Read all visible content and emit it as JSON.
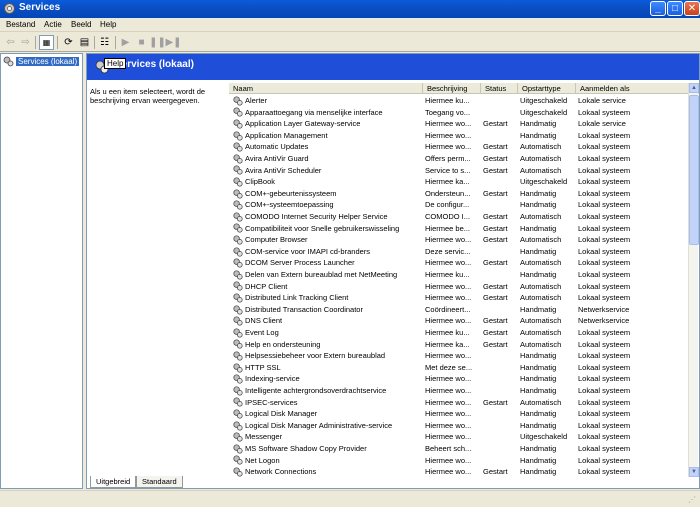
{
  "window": {
    "title": "Services",
    "minimize_glyph": "_",
    "maximize_glyph": "□",
    "close_glyph": "✕"
  },
  "menu": [
    "Bestand",
    "Actie",
    "Beeld",
    "Help"
  ],
  "toolbar_icons": [
    "back-arrow-icon",
    "forward-arrow-icon",
    "show-hide-tree-icon",
    "refresh-icon",
    "export-list-icon",
    "properties-icon",
    "start-service-icon",
    "stop-service-icon",
    "pause-service-icon",
    "restart-service-icon"
  ],
  "tree": {
    "root_label": "Services (lokaal)"
  },
  "banner": {
    "title": "Services (lokaal)",
    "tooltip": "Help"
  },
  "description_text": "Als u een item selecteert, wordt de beschrijving ervan weergegeven.",
  "columns": [
    "Naam",
    "Beschrijving",
    "Status",
    "Opstarttype",
    "Aanmelden als"
  ],
  "rows": [
    {
      "name": "Alerter",
      "desc": "Hiermee ku...",
      "status": "",
      "type": "Uitgeschakeld",
      "logon": "Lokale service"
    },
    {
      "name": "Apparaattoegang via menselijke interface",
      "desc": "Toegang vo...",
      "status": "",
      "type": "Uitgeschakeld",
      "logon": "Lokaal systeem"
    },
    {
      "name": "Application Layer Gateway-service",
      "desc": "Hiermee wo...",
      "status": "Gestart",
      "type": "Handmatig",
      "logon": "Lokale service"
    },
    {
      "name": "Application Management",
      "desc": "Hiermee wo...",
      "status": "",
      "type": "Handmatig",
      "logon": "Lokaal systeem"
    },
    {
      "name": "Automatic Updates",
      "desc": "Hiermee wo...",
      "status": "Gestart",
      "type": "Automatisch",
      "logon": "Lokaal systeem"
    },
    {
      "name": "Avira AntiVir Guard",
      "desc": "Offers perm...",
      "status": "Gestart",
      "type": "Automatisch",
      "logon": "Lokaal systeem"
    },
    {
      "name": "Avira AntiVir Scheduler",
      "desc": "Service to s...",
      "status": "Gestart",
      "type": "Automatisch",
      "logon": "Lokaal systeem"
    },
    {
      "name": "ClipBook",
      "desc": "Hiermee ka...",
      "status": "",
      "type": "Uitgeschakeld",
      "logon": "Lokaal systeem"
    },
    {
      "name": "COM+-gebeurtenissysteem",
      "desc": "Ondersteun...",
      "status": "Gestart",
      "type": "Handmatig",
      "logon": "Lokaal systeem"
    },
    {
      "name": "COM+-systeemtoepassing",
      "desc": "De configur...",
      "status": "",
      "type": "Handmatig",
      "logon": "Lokaal systeem"
    },
    {
      "name": "COMODO Internet Security Helper Service",
      "desc": "COMODO I...",
      "status": "Gestart",
      "type": "Automatisch",
      "logon": "Lokaal systeem"
    },
    {
      "name": "Compatibiliteit voor Snelle gebruikerswisseling",
      "desc": "Hiermee be...",
      "status": "Gestart",
      "type": "Handmatig",
      "logon": "Lokaal systeem"
    },
    {
      "name": "Computer Browser",
      "desc": "Hiermee wo...",
      "status": "Gestart",
      "type": "Automatisch",
      "logon": "Lokaal systeem"
    },
    {
      "name": "COM-service voor IMAPI cd-branders",
      "desc": "Deze servic...",
      "status": "",
      "type": "Handmatig",
      "logon": "Lokaal systeem"
    },
    {
      "name": "DCOM Server Process Launcher",
      "desc": "Hiermee wo...",
      "status": "Gestart",
      "type": "Automatisch",
      "logon": "Lokaal systeem"
    },
    {
      "name": "Delen van Extern bureaublad met NetMeeting",
      "desc": "Hiermee ku...",
      "status": "",
      "type": "Handmatig",
      "logon": "Lokaal systeem"
    },
    {
      "name": "DHCP Client",
      "desc": "Hiermee wo...",
      "status": "Gestart",
      "type": "Automatisch",
      "logon": "Lokaal systeem"
    },
    {
      "name": "Distributed Link Tracking Client",
      "desc": "Hiermee wo...",
      "status": "Gestart",
      "type": "Automatisch",
      "logon": "Lokaal systeem"
    },
    {
      "name": "Distributed Transaction Coordinator",
      "desc": "Coördineert...",
      "status": "",
      "type": "Handmatig",
      "logon": "Netwerkservice"
    },
    {
      "name": "DNS Client",
      "desc": "Hiermee wo...",
      "status": "Gestart",
      "type": "Automatisch",
      "logon": "Netwerkservice"
    },
    {
      "name": "Event Log",
      "desc": "Hiermee ku...",
      "status": "Gestart",
      "type": "Automatisch",
      "logon": "Lokaal systeem"
    },
    {
      "name": "Help en ondersteuning",
      "desc": "Hiermee ka...",
      "status": "Gestart",
      "type": "Automatisch",
      "logon": "Lokaal systeem"
    },
    {
      "name": "Helpsessiebeheer voor Extern bureaublad",
      "desc": "Hiermee wo...",
      "status": "",
      "type": "Handmatig",
      "logon": "Lokaal systeem"
    },
    {
      "name": "HTTP SSL",
      "desc": "Met deze se...",
      "status": "",
      "type": "Handmatig",
      "logon": "Lokaal systeem"
    },
    {
      "name": "Indexing-service",
      "desc": "Hiermee wo...",
      "status": "",
      "type": "Handmatig",
      "logon": "Lokaal systeem"
    },
    {
      "name": "Intelligente achtergrondsoverdrachtservice",
      "desc": "Hiermee wo...",
      "status": "",
      "type": "Handmatig",
      "logon": "Lokaal systeem"
    },
    {
      "name": "IPSEC-services",
      "desc": "Hiermee wo...",
      "status": "Gestart",
      "type": "Automatisch",
      "logon": "Lokaal systeem"
    },
    {
      "name": "Logical Disk Manager",
      "desc": "Hiermee wo...",
      "status": "",
      "type": "Handmatig",
      "logon": "Lokaal systeem"
    },
    {
      "name": "Logical Disk Manager Administrative-service",
      "desc": "Hiermee wo...",
      "status": "",
      "type": "Handmatig",
      "logon": "Lokaal systeem"
    },
    {
      "name": "Messenger",
      "desc": "Hiermee wo...",
      "status": "",
      "type": "Uitgeschakeld",
      "logon": "Lokaal systeem"
    },
    {
      "name": "MS Software Shadow Copy Provider",
      "desc": "Beheert sch...",
      "status": "",
      "type": "Handmatig",
      "logon": "Lokaal systeem"
    },
    {
      "name": "Net Logon",
      "desc": "Hiermee wo...",
      "status": "",
      "type": "Handmatig",
      "logon": "Lokaal systeem"
    },
    {
      "name": "Network Connections",
      "desc": "Hiermee wo...",
      "status": "Gestart",
      "type": "Handmatig",
      "logon": "Lokaal systeem"
    }
  ],
  "tabs": [
    "Uitgebreid",
    "Standaard"
  ]
}
